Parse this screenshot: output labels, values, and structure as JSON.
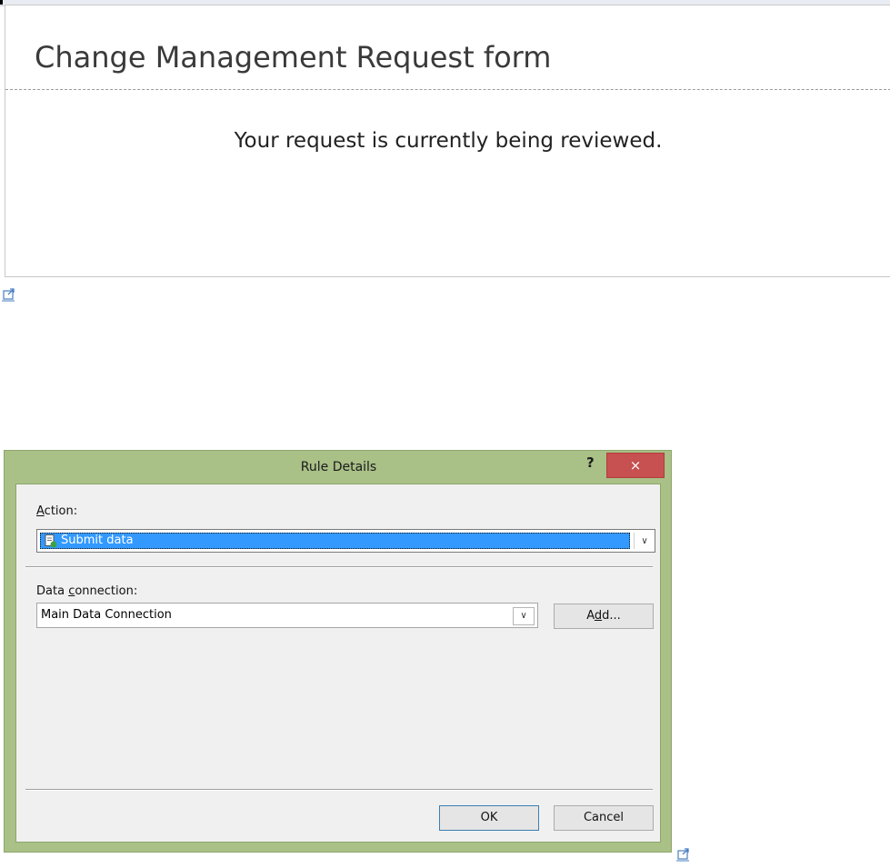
{
  "form": {
    "title": "Change Management Request form",
    "message": "Your request is currently being reviewed."
  },
  "dialog": {
    "title": "Rule Details",
    "help_label": "?",
    "close_label": "×",
    "action": {
      "label_prefix": "",
      "label_underlined": "A",
      "label_rest": "ction:",
      "selected_value": "Submit data",
      "icon": "document-submit-icon"
    },
    "data_connection": {
      "label_prefix": "Data ",
      "label_underlined": "c",
      "label_rest": "onnection:",
      "selected_value": "Main Data Connection"
    },
    "add_button": {
      "prefix": "A",
      "underlined": "d",
      "rest": "d..."
    },
    "ok_label": "OK",
    "cancel_label": "Cancel"
  },
  "icons": {
    "popout": "external-link-icon",
    "dropdown": "chevron-down-icon"
  },
  "colors": {
    "dialog_frame": "#a9c087",
    "close_button": "#c75050",
    "selection": "#3399ff"
  }
}
